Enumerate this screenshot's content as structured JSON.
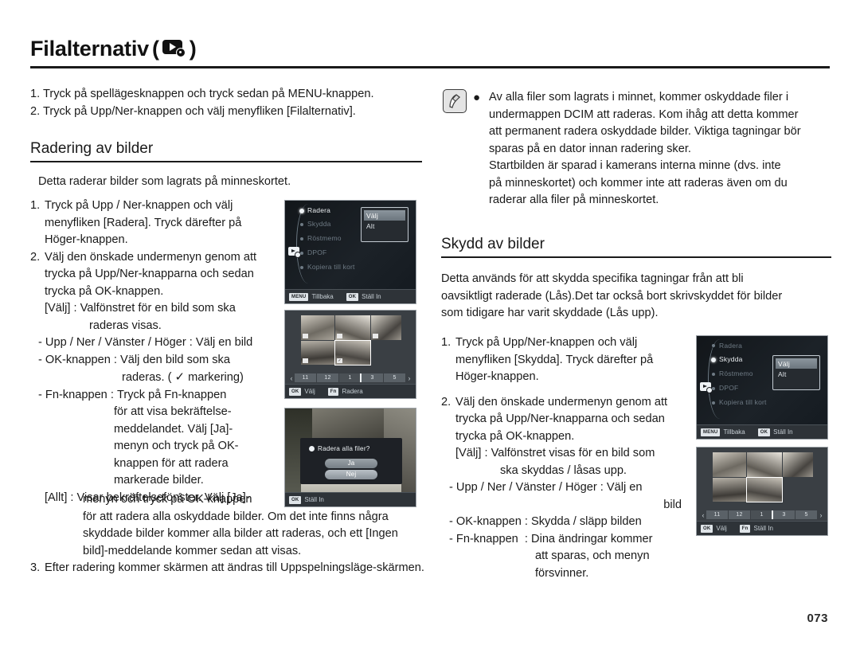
{
  "header": {
    "title": "Filalternativ",
    "icon": "playback-settings-icon",
    "paren_open": "(",
    "paren_close": ")"
  },
  "intro_steps": [
    "1. Tryck på spellägesknappen och tryck sedan på MENU-knappen.",
    "2. Tryck på Upp/Ner-knappen och välj menyfliken [Filalternativ]."
  ],
  "sections": {
    "radering": {
      "heading": "Radering av bilder",
      "lead": "Detta raderar bilder som lagrats på minneskortet.",
      "step1": {
        "num": "1.",
        "l1": "Tryck på Upp / Ner-knappen och välj",
        "l2": "menyfliken [Radera]. Tryck därefter på",
        "l3": "Höger-knappen."
      },
      "step2": {
        "num": "2.",
        "l1": "Välj den önskade undermenyn genom att",
        "l2": "trycka på Upp/Ner-knapparna och sedan",
        "l3": "trycka på OK-knappen.",
        "valj_lead": "[Välj] : ",
        "valj_l1": "Valfönstret för en bild som ska",
        "valj_l2": "raderas visas.",
        "dash_upp": "- Upp / Ner / Vänster / Höger : Välj en bild",
        "dash_ok_lead": "- OK-knappen : ",
        "dash_ok_l1": "Välj den bild som ska",
        "dash_ok_l2a": "raderas. ( ",
        "dash_ok_check": "✓",
        "dash_ok_l2b": " markering)",
        "dash_fn_lead": "- Fn-knappen : ",
        "dash_fn_l1": "Tryck på Fn-knappen",
        "dash_fn_l2": "för att visa bekräftelse-",
        "dash_fn_l3": "meddelandet. Välj [Ja]-",
        "dash_fn_l4": "menyn och tryck på OK-",
        "dash_fn_l5": "knappen för att radera",
        "dash_fn_l6": "markerade bilder.",
        "allt_lead": "[Allt] : ",
        "allt_l1": "Visar bekräftelsefönster. Välj [Ja]-",
        "allt_l2": "menyn och tryck på OK-knappen",
        "allt_l3": "för att radera alla oskyddade bilder. Om det inte finns några",
        "allt_l4": "skyddade bilder kommer alla bilder att raderas, och ett [Ingen",
        "allt_l5": "bild]-meddelande kommer sedan att visas."
      },
      "step3": {
        "num": "3.",
        "l1": "Efter radering kommer skärmen att ändras till Uppspelningsläge-skärmen."
      }
    },
    "skydd": {
      "heading": "Skydd av bilder",
      "lead_l1": "Detta används för att skydda specifika tagningar från att bli",
      "lead_l2": "oavsiktligt raderade (Lås).Det tar också bort skrivskyddet för bilder",
      "lead_l3": "som tidigare har varit skyddade (Lås upp).",
      "step1": {
        "num": "1.",
        "l1": "Tryck på Upp/Ner-knappen och välj",
        "l2": "menyfliken [Skydda]. Tryck därefter på",
        "l3": "Höger-knappen."
      },
      "step2": {
        "num": "2.",
        "l1": "Välj den önskade undermenyn genom att",
        "l2": "trycka på Upp/Ner-knapparna och sedan",
        "l3": "trycka på OK-knappen.",
        "valj_lead": "[Välj] : ",
        "valj_l1": "Valfönstret visas för en bild som",
        "valj_l2": "ska skyddas / låsas upp.",
        "dash_upp_l1": "- Upp / Ner / Vänster / Höger : Välj en",
        "dash_upp_l2": "bild",
        "dash_ok": "- OK-knappen : Skydda / släpp bilden",
        "dash_fn_lead": "- Fn-knappen  : ",
        "dash_fn_l1": "Dina ändringar kommer",
        "dash_fn_l2": "att sparas, och menyn",
        "dash_fn_l3": "försvinner."
      }
    }
  },
  "note": {
    "icon": "pen-note-icon",
    "bullet": "●",
    "lines": [
      "Av alla filer som lagrats i minnet, kommer oskyddade filer i",
      "undermappen DCIM att raderas. Kom ihåg att detta kommer",
      "att permanent radera oskyddade bilder. Viktiga tagningar bör",
      "sparas på en dator innan radering sker.",
      "Startbilden är sparad i kamerans interna minne (dvs. inte",
      "på minneskortet) och kommer inte att raderas även om du",
      "raderar alla filer på minneskortet."
    ]
  },
  "screens": {
    "menu_delete": {
      "name": "camera-menu-delete",
      "items": [
        "Radera",
        "Skydda",
        "Röstmemo",
        "DPOF",
        "Kopiera till kort"
      ],
      "active_item": "Radera",
      "submenu": [
        "Välj",
        "Alt"
      ],
      "submenu_selected": "Välj",
      "ctrl_left_key": "MENU",
      "ctrl_left_label": "Tillbaka",
      "ctrl_right_key": "OK",
      "ctrl_right_label": "Ställ In"
    },
    "grid_delete": {
      "name": "camera-thumbnail-grid-delete",
      "scrubber": [
        "11",
        "12",
        "1",
        "3",
        "5"
      ],
      "ctrl_left_key": "OK",
      "ctrl_left_label": "Välj",
      "ctrl_right_key": "Fn",
      "ctrl_right_label": "Radera"
    },
    "dialog_delete": {
      "name": "camera-confirm-dialog",
      "title": "Radera alla filer?",
      "yes": "Ja",
      "no": "Nej",
      "ctrl_left_key": "OK",
      "ctrl_left_label": "Ställ In"
    },
    "menu_protect": {
      "name": "camera-menu-protect",
      "items": [
        "Radera",
        "Skydda",
        "Röstmemo",
        "DPOF",
        "Kopiera till kort"
      ],
      "active_item": "Skydda",
      "submenu": [
        "Välj",
        "Alt"
      ],
      "submenu_selected": "Välj",
      "ctrl_left_key": "MENU",
      "ctrl_left_label": "Tillbaka",
      "ctrl_right_key": "OK",
      "ctrl_right_label": "Ställ In"
    },
    "grid_protect": {
      "name": "camera-thumbnail-grid-protect",
      "scrubber": [
        "11",
        "12",
        "1",
        "3",
        "5"
      ],
      "ctrl_left_key": "OK",
      "ctrl_left_label": "Välj",
      "ctrl_right_key": "Fn",
      "ctrl_right_label": "Ställ In"
    }
  },
  "page_number": "073"
}
